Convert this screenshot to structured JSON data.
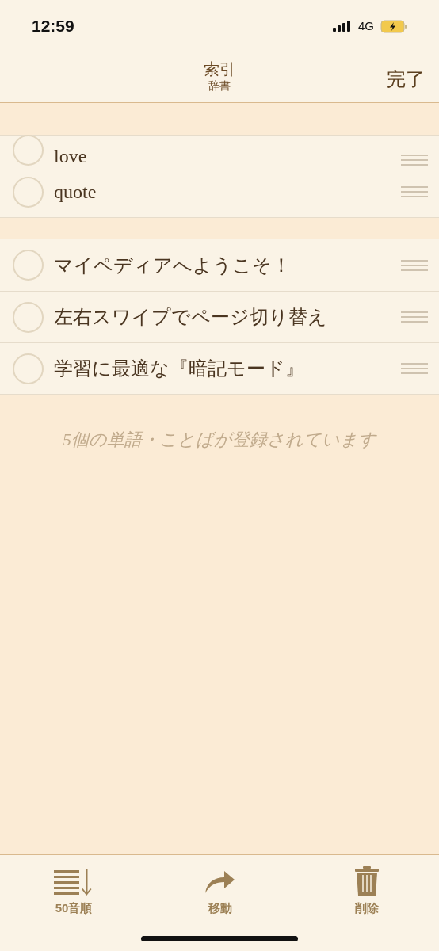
{
  "status_bar": {
    "time": "12:59",
    "network": "4G"
  },
  "nav": {
    "title": "索引",
    "subtitle": "辞書",
    "done": "完了"
  },
  "sections": [
    {
      "items": [
        {
          "text": "love",
          "selected": false,
          "kind": "lifted"
        },
        {
          "text": "quote",
          "selected": false,
          "kind": "normal"
        }
      ]
    },
    {
      "items": [
        {
          "text": "マイペディアへようこそ！",
          "selected": false,
          "kind": "normal"
        },
        {
          "text": "左右スワイプでページ切り替え",
          "selected": false,
          "kind": "normal"
        },
        {
          "text": "学習に最適な『暗記モード』",
          "selected": false,
          "kind": "normal"
        }
      ]
    }
  ],
  "footer_text": "5個の単語・ことばが登録されています",
  "toolbar": [
    {
      "label": "50音順",
      "kind": "sort"
    },
    {
      "label": "移動",
      "kind": "move"
    },
    {
      "label": "削除",
      "kind": "delete"
    }
  ]
}
